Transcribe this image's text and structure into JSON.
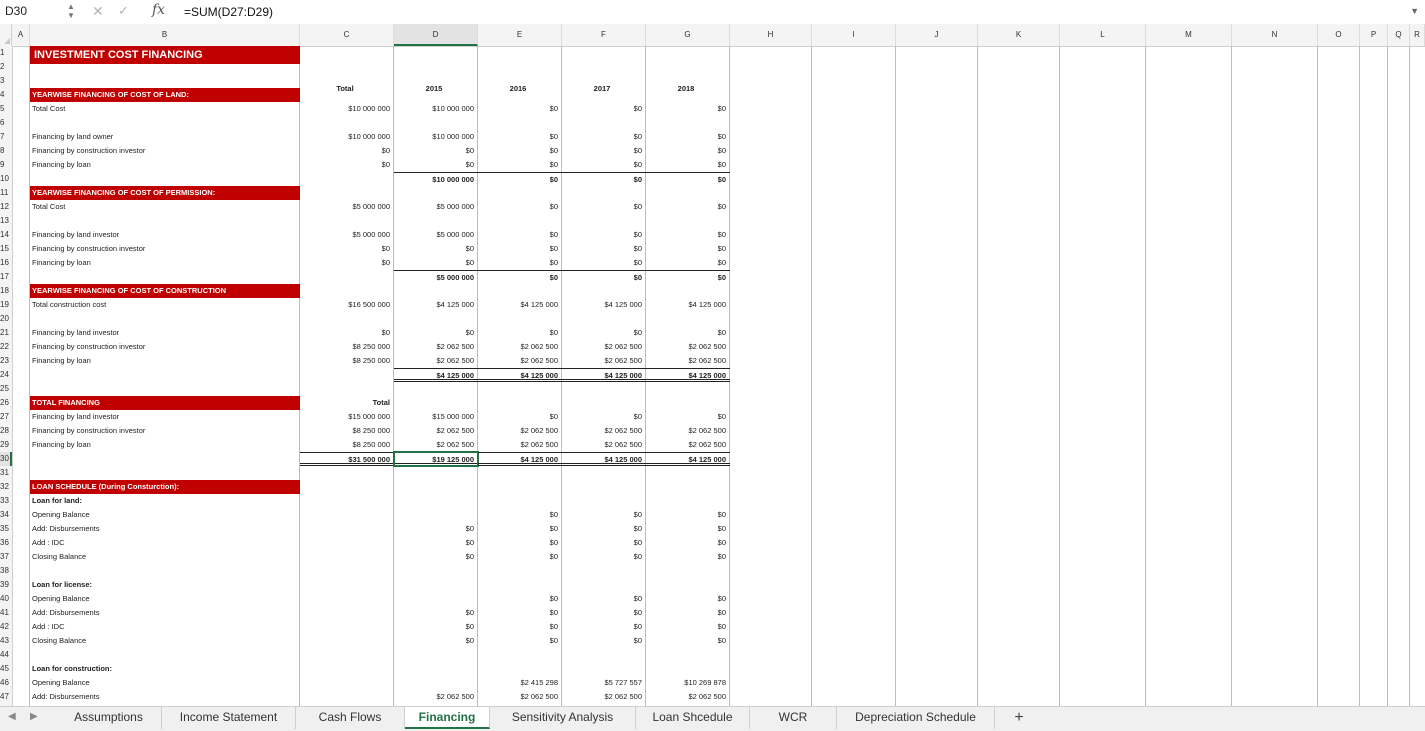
{
  "formula_bar": {
    "name_box": "D30",
    "fx": "fx",
    "formula": "=SUM(D27:D29)"
  },
  "columns": [
    "A",
    "B",
    "C",
    "D",
    "E",
    "F",
    "G",
    "H",
    "I",
    "J",
    "K",
    "L",
    "M",
    "N",
    "O",
    "P",
    "Q",
    "R"
  ],
  "selected_column": "D",
  "rows": [
    "1",
    "2",
    "3",
    "4",
    "5",
    "6",
    "7",
    "8",
    "9",
    "10",
    "11",
    "12",
    "13",
    "14",
    "15",
    "16",
    "17",
    "18",
    "19",
    "20",
    "21",
    "22",
    "23",
    "24",
    "25",
    "26",
    "27",
    "28",
    "29",
    "30",
    "31",
    "32",
    "33",
    "34",
    "35",
    "36",
    "37",
    "38",
    "39",
    "40",
    "41",
    "42",
    "43",
    "44",
    "45",
    "46",
    "47"
  ],
  "selected_row": "30",
  "sheet": {
    "title": "INVESTMENT COST FINANCING",
    "headers": {
      "total": "Total",
      "years": [
        "2015",
        "2016",
        "2017",
        "2018"
      ]
    },
    "land": {
      "header": "YEARWISE FINANCING OF COST OF LAND:",
      "total_label": "Total Cost",
      "total": [
        "$10 000 000",
        "$10 000 000",
        "$0",
        "$0",
        "$0"
      ],
      "items": [
        {
          "label": "Financing by land owner",
          "values": [
            "$10 000 000",
            "$10 000 000",
            "$0",
            "$0",
            "$0"
          ]
        },
        {
          "label": "Financing by construction investor",
          "values": [
            "$0",
            "$0",
            "$0",
            "$0",
            "$0"
          ]
        },
        {
          "label": "Financing by loan",
          "values": [
            "$0",
            "$0",
            "$0",
            "$0",
            "$0"
          ]
        }
      ],
      "sum": [
        "$10 000 000",
        "$0",
        "$0",
        "$0"
      ]
    },
    "permission": {
      "header": "YEARWISE FINANCING OF COST OF PERMISSION:",
      "total_label": "Total Cost",
      "total": [
        "$5 000 000",
        "$5 000 000",
        "$0",
        "$0",
        "$0"
      ],
      "items": [
        {
          "label": "Financing by land investor",
          "values": [
            "$5 000 000",
            "$5 000 000",
            "$0",
            "$0",
            "$0"
          ]
        },
        {
          "label": "Financing by construction investor",
          "values": [
            "$0",
            "$0",
            "$0",
            "$0",
            "$0"
          ]
        },
        {
          "label": "Financing by loan",
          "values": [
            "$0",
            "$0",
            "$0",
            "$0",
            "$0"
          ]
        }
      ],
      "sum": [
        "$5 000 000",
        "$0",
        "$0",
        "$0"
      ]
    },
    "construction": {
      "header": "YEARWISE FINANCING OF COST OF CONSTRUCTION",
      "total_label": "Total construction cost",
      "total": [
        "$16 500 000",
        "$4 125 000",
        "$4 125 000",
        "$4 125 000",
        "$4 125 000"
      ],
      "items": [
        {
          "label": "Financing by land investor",
          "values": [
            "$0",
            "$0",
            "$0",
            "$0",
            "$0"
          ]
        },
        {
          "label": "Financing by construction investor",
          "values": [
            "$8 250 000",
            "$2 062 500",
            "$2 062 500",
            "$2 062 500",
            "$2 062 500"
          ]
        },
        {
          "label": "Financing by loan",
          "values": [
            "$8 250 000",
            "$2 062 500",
            "$2 062 500",
            "$2 062 500",
            "$2 062 500"
          ]
        }
      ],
      "sum": [
        "$4 125 000",
        "$4 125 000",
        "$4 125 000",
        "$4 125 000"
      ]
    },
    "total_financing": {
      "header": "TOTAL FINANCING",
      "total_header": "Total",
      "items": [
        {
          "label": "Financing by land investor",
          "values": [
            "$15 000 000",
            "$15 000 000",
            "$0",
            "$0",
            "$0"
          ]
        },
        {
          "label": "Financing by construction investor",
          "values": [
            "$8 250 000",
            "$2 062 500",
            "$2 062 500",
            "$2 062 500",
            "$2 062 500"
          ]
        },
        {
          "label": "Financing by loan",
          "values": [
            "$8 250 000",
            "$2 062 500",
            "$2 062 500",
            "$2 062 500",
            "$2 062 500"
          ]
        }
      ],
      "sum": [
        "$31 500 000",
        "$19 125 000",
        "$4 125 000",
        "$4 125 000",
        "$4 125 000"
      ]
    },
    "loan_schedule": {
      "header": "LOAN SCHEDULE (During Consturction):",
      "land": {
        "title": "Loan for land:",
        "opening_label": "Opening Balance",
        "opening": [
          "$0",
          "$0",
          "$0"
        ],
        "disb_label": "Add: Disbursements",
        "disb": [
          "$0",
          "$0",
          "$0",
          "$0"
        ],
        "idc_label": "Add : IDC",
        "idc": [
          "$0",
          "$0",
          "$0",
          "$0"
        ],
        "closing_label": "Closing Balance",
        "closing": [
          "$0",
          "$0",
          "$0",
          "$0"
        ]
      },
      "license": {
        "title": "Loan for license:",
        "opening_label": "Opening Balance",
        "opening": [
          "$0",
          "$0",
          "$0"
        ],
        "disb_label": "Add: Disbursements",
        "disb": [
          "$0",
          "$0",
          "$0",
          "$0"
        ],
        "idc_label": "Add : IDC",
        "idc": [
          "$0",
          "$0",
          "$0",
          "$0"
        ],
        "closing_label": "Closing Balance",
        "closing": [
          "$0",
          "$0",
          "$0",
          "$0"
        ]
      },
      "construction": {
        "title": "Loan for construction:",
        "opening_label": "Opening Balance",
        "opening": [
          "$2 415 298",
          "$5 727 557",
          "$10 269 878"
        ],
        "disb_label": "Add: Disbursements",
        "disb": [
          "$2 062 500",
          "$2 062 500",
          "$2 062 500",
          "$2 062 500"
        ]
      }
    }
  },
  "tabs": [
    "Assumptions",
    "Income Statement",
    "Cash Flows",
    "Financing",
    "Sensitivity Analysis",
    "Loan Shcedule",
    "WCR",
    "Depreciation Schedule"
  ],
  "active_tab": "Financing",
  "add_tab": "+"
}
